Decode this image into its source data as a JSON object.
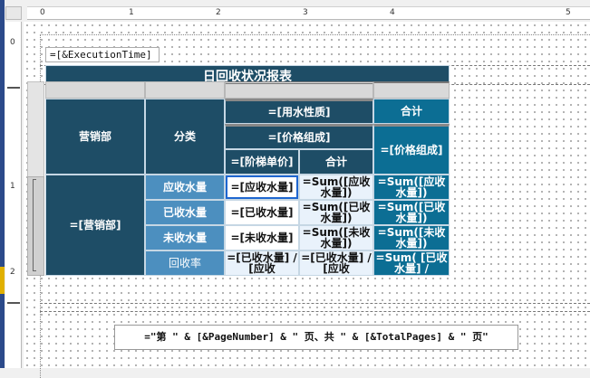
{
  "ruler": {
    "top_numbers": [
      "0",
      "1",
      "2",
      "3",
      "4",
      "5"
    ],
    "left_numbers": [
      "0",
      "1",
      "2"
    ]
  },
  "header": {
    "execution_time": "=[&ExecutionTime]",
    "report_title": "日回收状况报表"
  },
  "table": {
    "dept_header": "营销部",
    "category_header": "分类",
    "water_nature": "=[用水性质]",
    "price_composition": "=[价格组成]",
    "tier_price": "=[阶梯单价]",
    "subtotal": "合计",
    "total_header": "合计",
    "total_price_composition": "=[价格组成]",
    "dept_field": "=[营销部]",
    "rows": [
      {
        "label": "应收水量",
        "field": "=[应收水量]",
        "sum1": "=Sum([应收水量])",
        "sum2": "=Sum([应收水量])"
      },
      {
        "label": "已收水量",
        "field": "=[已收水量]",
        "sum1": "=Sum([已收水量])",
        "sum2": "=Sum([已收水量])"
      },
      {
        "label": "未收水量",
        "field": "=[未收水量]",
        "sum1": "=Sum([未收水量])",
        "sum2": "=Sum([未收水量])"
      },
      {
        "label": "回收率",
        "field": "=[已收水量] / [应收",
        "sum1": "=[已收水量] / [应收",
        "sum2": "=Sum( [已收水量] /"
      }
    ]
  },
  "footer": {
    "page_expression": "=\"第 \" & [&PageNumber] & \" 页、共 \" & [&TotalPages] & \" 页\""
  }
}
